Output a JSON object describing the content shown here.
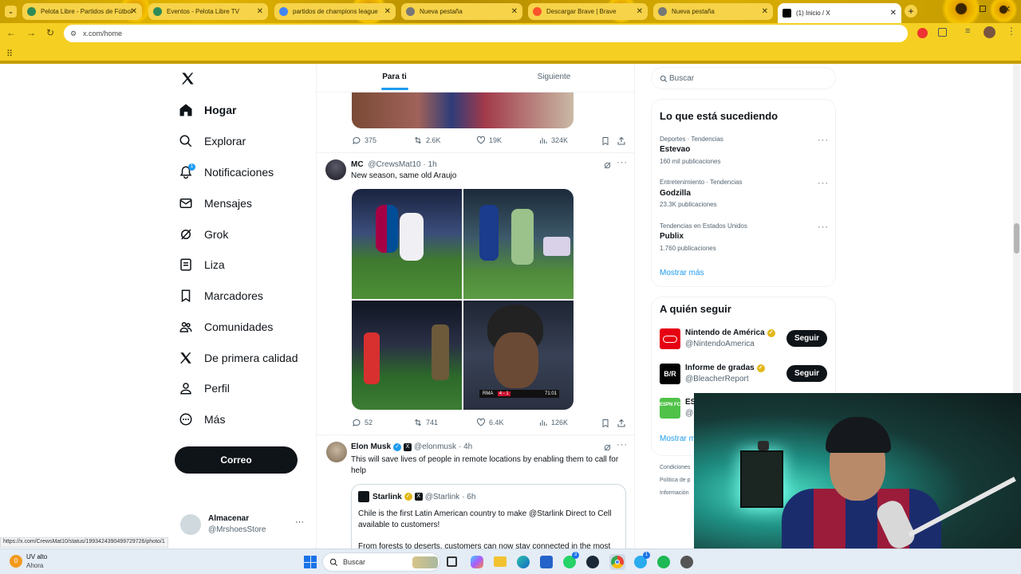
{
  "browser": {
    "tabs": [
      {
        "label": "Pelota Libre - Partidos de Fútbol",
        "color": "#2e8b57"
      },
      {
        "label": "Eventos - Pelota Libre TV",
        "color": "#2e8b57"
      },
      {
        "label": "partidos de champions league",
        "color": "#4285f4"
      },
      {
        "label": "Nueva pestaña",
        "color": "#777777"
      },
      {
        "label": "Descargar Brave | Brave",
        "color": "#fb542b"
      },
      {
        "label": "Nueva pestaña",
        "color": "#777777"
      },
      {
        "label": "(1) Inicio / X",
        "color": "#000000"
      }
    ],
    "url": "x.com/home",
    "status_url": "https://x.com/CrewsMat10/status/1993424390499729726/photo/1"
  },
  "nav": {
    "items": [
      {
        "label": "Hogar",
        "icon": "home-icon"
      },
      {
        "label": "Explorar",
        "icon": "search-icon"
      },
      {
        "label": "Notificaciones",
        "icon": "bell-icon"
      },
      {
        "label": "Mensajes",
        "icon": "mail-icon"
      },
      {
        "label": "Grok",
        "icon": "grok-icon"
      },
      {
        "label": "Liza",
        "icon": "list-icon"
      },
      {
        "label": "Marcadores",
        "icon": "bookmark-icon"
      },
      {
        "label": "Comunidades",
        "icon": "communities-icon"
      },
      {
        "label": "De primera calidad",
        "icon": "x-icon"
      },
      {
        "label": "Perfil",
        "icon": "person-icon"
      },
      {
        "label": "Más",
        "icon": "more-icon"
      }
    ],
    "notif_badge": "1",
    "post_button": "Correo",
    "account": {
      "name": "Almacenar",
      "handle": "@MrshoesStore"
    }
  },
  "feed": {
    "tabs": [
      "Para ti",
      "Siguiente"
    ],
    "prev_tweet_counts": {
      "replies": "375",
      "reposts": "2.6K",
      "likes": "19K",
      "views": "324K"
    },
    "tweet1": {
      "name": "MC",
      "handle": "@CrewsMat10",
      "time": "· 1h",
      "text": "New season, same old Araujo",
      "score_bug": {
        "team": "RMA",
        "score": "4 - 1",
        "clock": "71:01"
      },
      "counts": {
        "replies": "52",
        "reposts": "741",
        "likes": "6.4K",
        "views": "126K"
      }
    },
    "tweet2": {
      "name": "Elon Musk",
      "handle": "@elonmusk",
      "time": "· 4h",
      "text": "This will save lives of people in remote locations by enabling them to call for help",
      "quote": {
        "name": "Starlink",
        "handle": "@Starlink",
        "time": "· 6h",
        "text1": "Chile is the first Latin American country to make @Starlink Direct to Cell available to customers!",
        "text2": "From forests to deserts, customers can now stay connected in the most"
      }
    }
  },
  "sidebar": {
    "search_placeholder": "Buscar",
    "trends_title": "Lo que está sucediendo",
    "trends": [
      {
        "meta": "Deportes · Tendencias",
        "name": "Estevao",
        "count": "160 mil publicaciones"
      },
      {
        "meta": "Entretenimiento · Tendencias",
        "name": "Godzilla",
        "count": "23.3K publicaciones"
      },
      {
        "meta": "Tendencias en Estados Unidos",
        "name": "Publix",
        "count": "1.760 publicaciones"
      }
    ],
    "show_more": "Mostrar más",
    "follow_title": "A quién seguir",
    "follow": [
      {
        "name": "Nintendo de América",
        "handle": "@NintendoAmerica",
        "button": "Seguir",
        "avatar_color": "#e60012"
      },
      {
        "name": "Informe de gradas",
        "handle": "@BleacherReport",
        "button": "Seguir",
        "avatar_color": "#000000",
        "avatar_text": "B/R"
      },
      {
        "name": "ES",
        "handle": "@",
        "avatar_color": "#4fc247",
        "avatar_text": "ESPN FC"
      }
    ],
    "show_more2": "Mostrar m",
    "footer": [
      "Condiciones",
      "Política de p",
      "Información"
    ]
  },
  "taskbar": {
    "weather_temp": "0",
    "weather_title": "UV alto",
    "weather_sub": "Ahora",
    "search": "Buscar",
    "badges": {
      "whatsapp": "3",
      "telegram": "1"
    }
  }
}
